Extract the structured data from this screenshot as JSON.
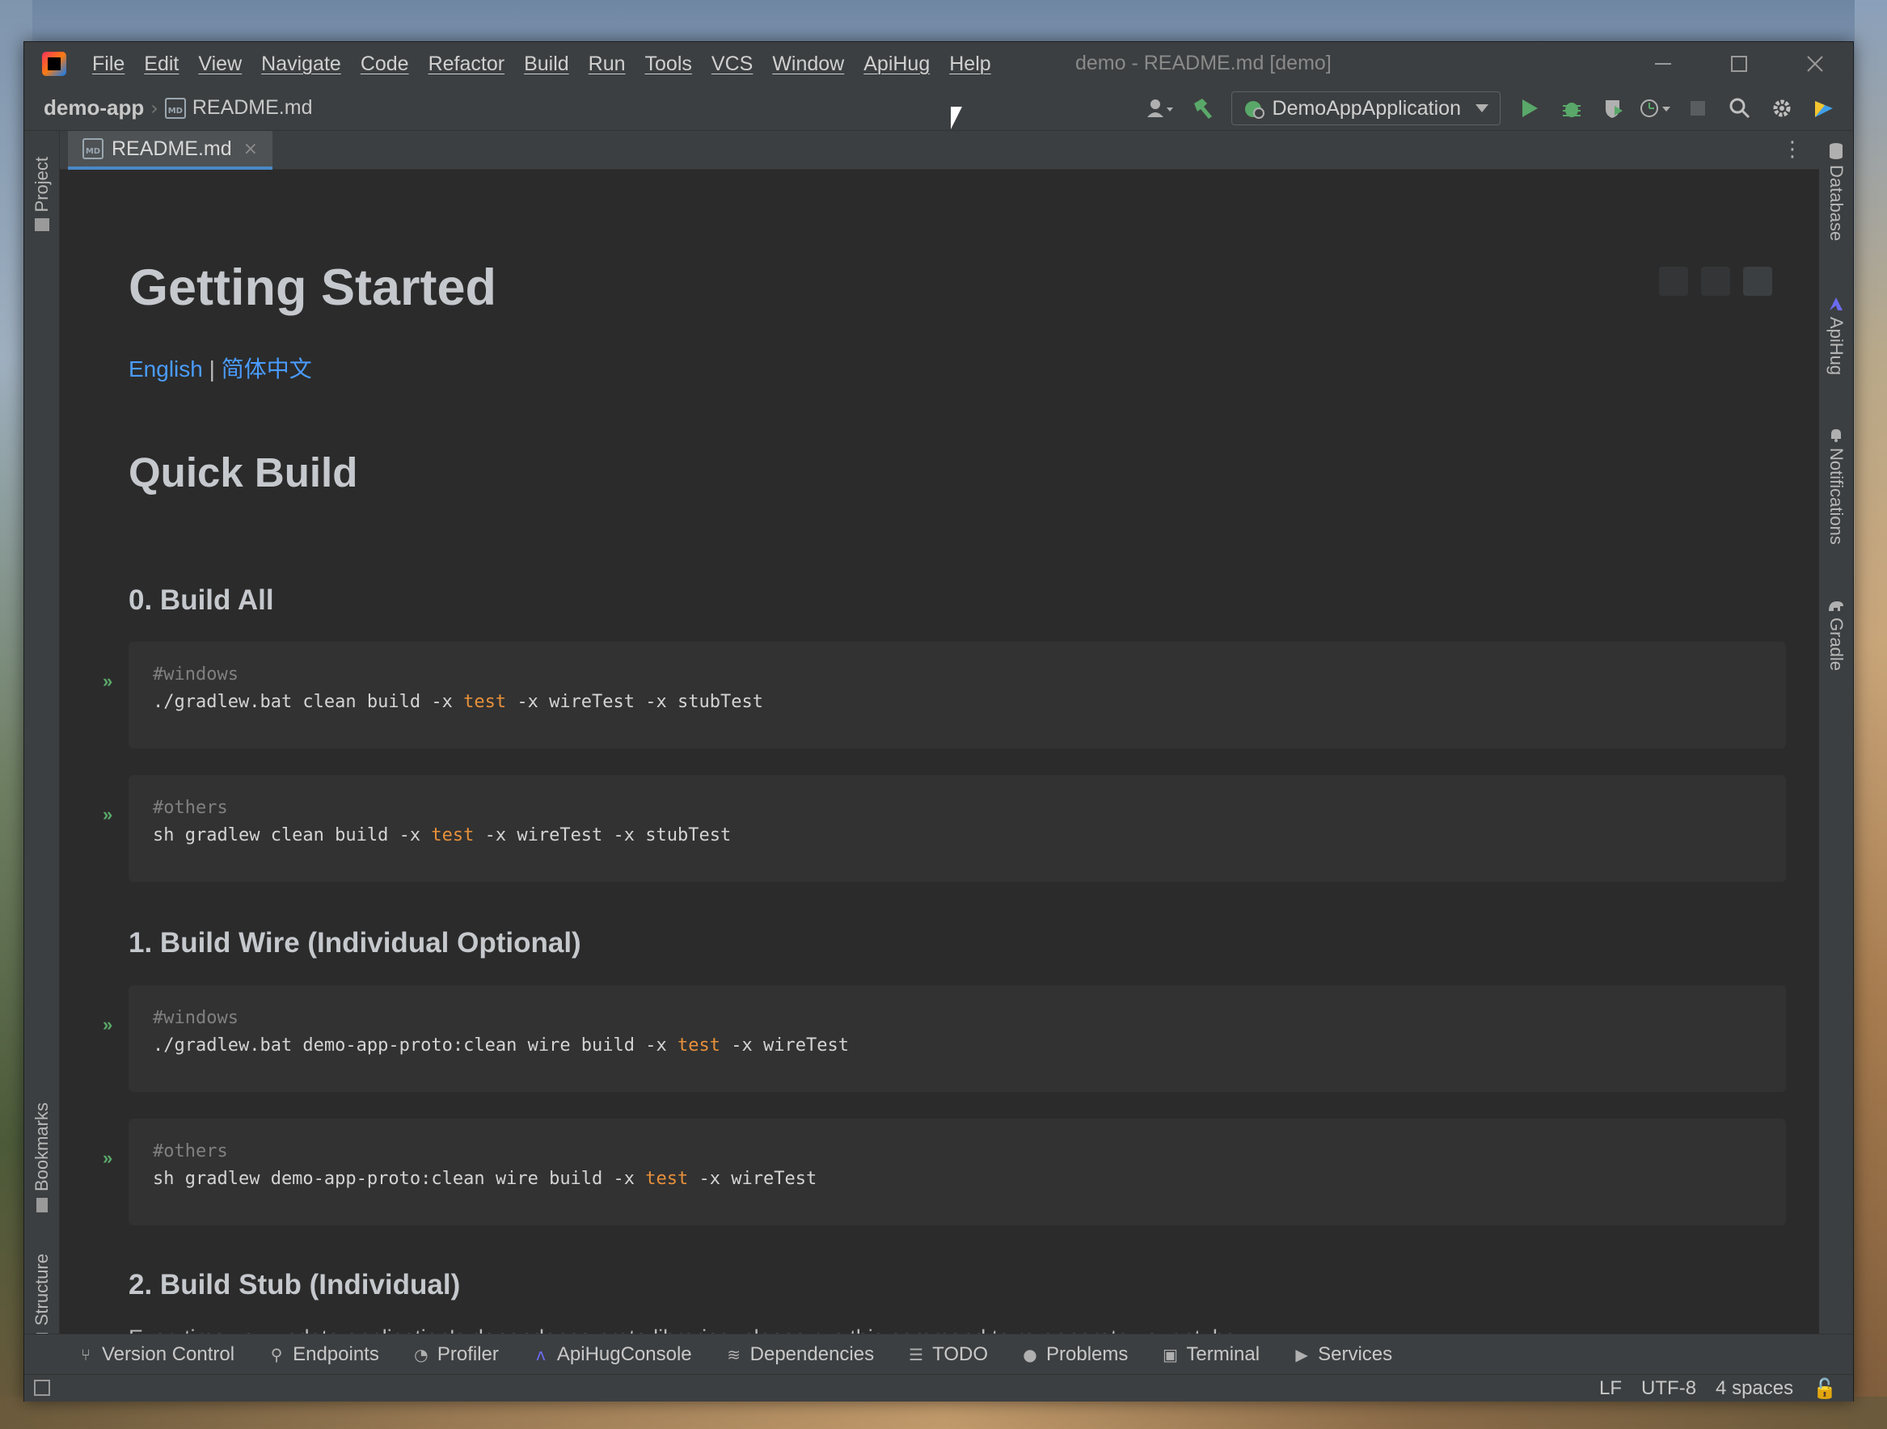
{
  "window": {
    "title": "demo - README.md [demo]",
    "menu": [
      "File",
      "Edit",
      "View",
      "Navigate",
      "Code",
      "Refactor",
      "Build",
      "Run",
      "Tools",
      "VCS",
      "Window",
      "ApiHug",
      "Help"
    ]
  },
  "navbar": {
    "project": "demo-app",
    "file": "README.md",
    "file_icon": "MD",
    "run_config": "DemoAppApplication"
  },
  "left_stripe": {
    "top": "Project",
    "bookmarks": "Bookmarks",
    "structure": "Structure"
  },
  "right_stripe": [
    "Database",
    "ApiHug",
    "Notifications",
    "Gradle"
  ],
  "tab": {
    "label": "README.md",
    "close": "×"
  },
  "doc": {
    "h1": "Getting Started",
    "lang_en": "English",
    "lang_sep": "|",
    "lang_zh": "简体中文",
    "h1b": "Quick Build",
    "s0": "0. Build All",
    "s1": "1. Build Wire (Individual Optional)",
    "s2": "2. Build Stub (Individual)",
    "para": "Everytime you update application's dependence proto libraries, please run this command to re-generate your stubs.",
    "blocks": [
      {
        "comment": "#windows",
        "pre": "./gradlew.bat clean build -x ",
        "kw": "test",
        "post": " -x wireTest -x stubTest"
      },
      {
        "comment": "#others",
        "pre": "sh gradlew clean build -x ",
        "kw": "test",
        "post": " -x wireTest -x stubTest"
      },
      {
        "comment": "#windows",
        "pre": "./gradlew.bat demo-app-proto:clean wire build -x ",
        "kw": "test",
        "post": " -x wireTest"
      },
      {
        "comment": "#others",
        "pre": "sh gradlew demo-app-proto:clean wire build -x ",
        "kw": "test",
        "post": " -x wireTest"
      }
    ]
  },
  "bottom_tools": [
    "Version Control",
    "Endpoints",
    "Profiler",
    "ApiHugConsole",
    "Dependencies",
    "TODO",
    "Problems",
    "Terminal",
    "Services"
  ],
  "status": {
    "line_sep": "LF",
    "encoding": "UTF-8",
    "indent": "4 spaces"
  },
  "colors": {
    "accent": "#4a88c7",
    "link": "#4a9cff",
    "keyword": "#e8903a",
    "run_green": "#59a869"
  }
}
